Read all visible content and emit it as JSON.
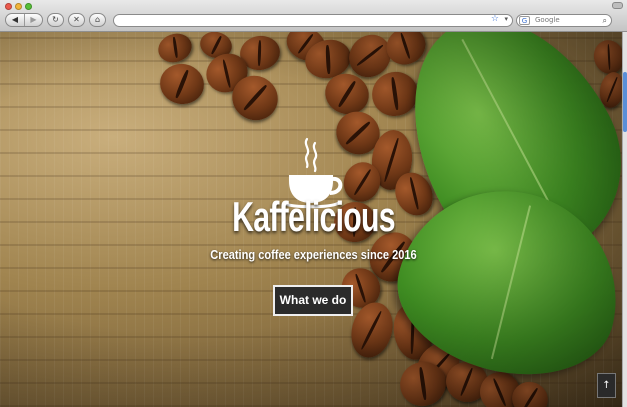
{
  "browser": {
    "back_icon": "◀",
    "forward_icon": "▶",
    "reload_icon": "↻",
    "stop_icon": "✕",
    "home_icon": "⌂",
    "url": "",
    "search_placeholder": "Google",
    "search_engine_icon": "G",
    "bookmark_icon": "☆",
    "dropdown_icon": "▾",
    "search_icon": "⌕"
  },
  "hero": {
    "title": "Kaffelicious",
    "subtitle": "Creating coffee experiences since 2016",
    "cta_label": "What we do",
    "back_to_top_icon": "↑"
  },
  "colors": {
    "cta_background": "#2b2b2b",
    "cta_border": "#efefef",
    "title": "#ffffff"
  }
}
